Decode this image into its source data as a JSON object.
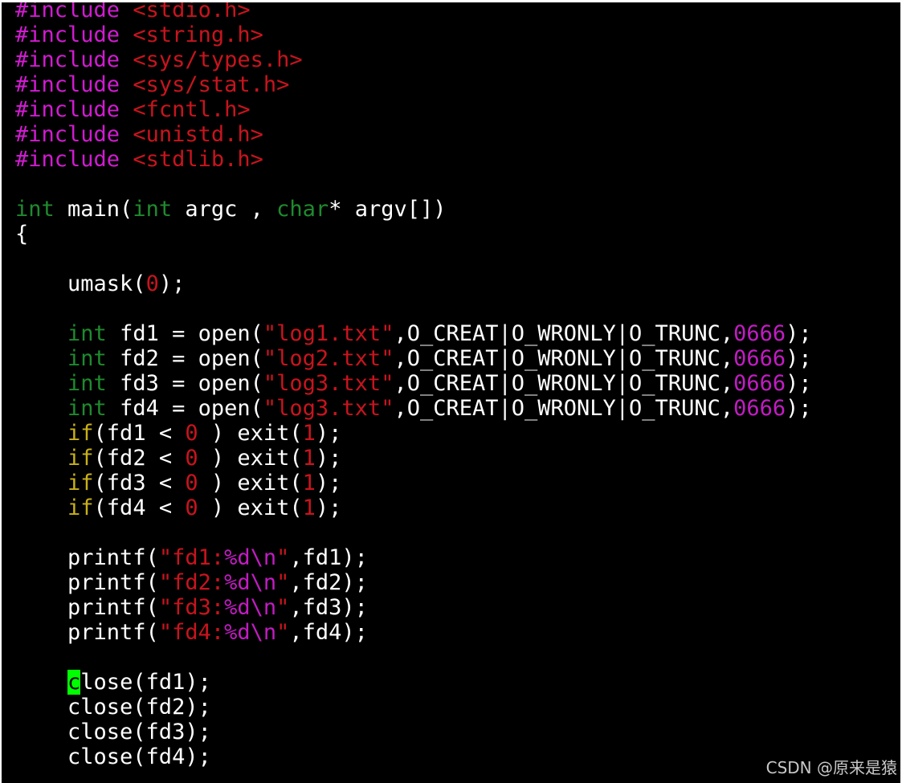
{
  "editor": {
    "colors": {
      "background": "#000000",
      "default": "#ffffff",
      "preproc": "#d21bd2",
      "string": "#c8141e",
      "type": "#1f8a2e",
      "number": "#c8141e",
      "octal": "#c21cc2",
      "keyword": "#c9b11a",
      "special": "#c21cc2",
      "cursor_bg": "#00ff00",
      "cursor_fg": "#000000"
    },
    "cursor_char": "c",
    "lines": [
      [
        [
          "preproc",
          "#include "
        ],
        [
          "string",
          "<stdio.h>"
        ]
      ],
      [
        [
          "preproc",
          "#include "
        ],
        [
          "string",
          "<string.h>"
        ]
      ],
      [
        [
          "preproc",
          "#include "
        ],
        [
          "string",
          "<sys/types.h>"
        ]
      ],
      [
        [
          "preproc",
          "#include "
        ],
        [
          "string",
          "<sys/stat.h>"
        ]
      ],
      [
        [
          "preproc",
          "#include "
        ],
        [
          "string",
          "<fcntl.h>"
        ]
      ],
      [
        [
          "preproc",
          "#include "
        ],
        [
          "string",
          "<unistd.h>"
        ]
      ],
      [
        [
          "preproc",
          "#include "
        ],
        [
          "string",
          "<stdlib.h>"
        ]
      ],
      [],
      [
        [
          "type",
          "int"
        ],
        [
          "default",
          " main("
        ],
        [
          "type",
          "int"
        ],
        [
          "default",
          " argc , "
        ],
        [
          "type",
          "char"
        ],
        [
          "default",
          "* argv[])"
        ]
      ],
      [
        [
          "default",
          "{"
        ]
      ],
      [],
      [
        [
          "default",
          "    umask("
        ],
        [
          "number",
          "0"
        ],
        [
          "default",
          ");"
        ]
      ],
      [],
      [
        [
          "default",
          "    "
        ],
        [
          "type",
          "int"
        ],
        [
          "default",
          " fd1 = open("
        ],
        [
          "string",
          "\"log1.txt\""
        ],
        [
          "default",
          ",O_CREAT|O_WRONLY|O_TRUNC,"
        ],
        [
          "octal",
          "0666"
        ],
        [
          "default",
          ");"
        ]
      ],
      [
        [
          "default",
          "    "
        ],
        [
          "type",
          "int"
        ],
        [
          "default",
          " fd2 = open("
        ],
        [
          "string",
          "\"log2.txt\""
        ],
        [
          "default",
          ",O_CREAT|O_WRONLY|O_TRUNC,"
        ],
        [
          "octal",
          "0666"
        ],
        [
          "default",
          ");"
        ]
      ],
      [
        [
          "default",
          "    "
        ],
        [
          "type",
          "int"
        ],
        [
          "default",
          " fd3 = open("
        ],
        [
          "string",
          "\"log3.txt\""
        ],
        [
          "default",
          ",O_CREAT|O_WRONLY|O_TRUNC,"
        ],
        [
          "octal",
          "0666"
        ],
        [
          "default",
          ");"
        ]
      ],
      [
        [
          "default",
          "    "
        ],
        [
          "type",
          "int"
        ],
        [
          "default",
          " fd4 = open("
        ],
        [
          "string",
          "\"log3.txt\""
        ],
        [
          "default",
          ",O_CREAT|O_WRONLY|O_TRUNC,"
        ],
        [
          "octal",
          "0666"
        ],
        [
          "default",
          ");"
        ]
      ],
      [
        [
          "default",
          "    "
        ],
        [
          "keyword",
          "if"
        ],
        [
          "default",
          "(fd1 < "
        ],
        [
          "number",
          "0"
        ],
        [
          "default",
          " ) exit("
        ],
        [
          "number",
          "1"
        ],
        [
          "default",
          ");"
        ]
      ],
      [
        [
          "default",
          "    "
        ],
        [
          "keyword",
          "if"
        ],
        [
          "default",
          "(fd2 < "
        ],
        [
          "number",
          "0"
        ],
        [
          "default",
          " ) exit("
        ],
        [
          "number",
          "1"
        ],
        [
          "default",
          ");"
        ]
      ],
      [
        [
          "default",
          "    "
        ],
        [
          "keyword",
          "if"
        ],
        [
          "default",
          "(fd3 < "
        ],
        [
          "number",
          "0"
        ],
        [
          "default",
          " ) exit("
        ],
        [
          "number",
          "1"
        ],
        [
          "default",
          ");"
        ]
      ],
      [
        [
          "default",
          "    "
        ],
        [
          "keyword",
          "if"
        ],
        [
          "default",
          "(fd4 < "
        ],
        [
          "number",
          "0"
        ],
        [
          "default",
          " ) exit("
        ],
        [
          "number",
          "1"
        ],
        [
          "default",
          ");"
        ]
      ],
      [],
      [
        [
          "default",
          "    printf("
        ],
        [
          "string",
          "\"fd1:"
        ],
        [
          "special",
          "%d\\n"
        ],
        [
          "string",
          "\""
        ],
        [
          "default",
          ",fd1);"
        ]
      ],
      [
        [
          "default",
          "    printf("
        ],
        [
          "string",
          "\"fd2:"
        ],
        [
          "special",
          "%d\\n"
        ],
        [
          "string",
          "\""
        ],
        [
          "default",
          ",fd2);"
        ]
      ],
      [
        [
          "default",
          "    printf("
        ],
        [
          "string",
          "\"fd3:"
        ],
        [
          "special",
          "%d\\n"
        ],
        [
          "string",
          "\""
        ],
        [
          "default",
          ",fd3);"
        ]
      ],
      [
        [
          "default",
          "    printf("
        ],
        [
          "string",
          "\"fd4:"
        ],
        [
          "special",
          "%d\\n"
        ],
        [
          "string",
          "\""
        ],
        [
          "default",
          ",fd4);"
        ]
      ],
      [],
      [
        [
          "default",
          "    "
        ],
        [
          "cursor",
          "c"
        ],
        [
          "default",
          "lose(fd1);"
        ]
      ],
      [
        [
          "default",
          "    close(fd2);"
        ]
      ],
      [
        [
          "default",
          "    close(fd3);"
        ]
      ],
      [
        [
          "default",
          "    close(fd4);"
        ]
      ]
    ]
  },
  "watermark": {
    "text": "CSDN @原来是猿"
  }
}
